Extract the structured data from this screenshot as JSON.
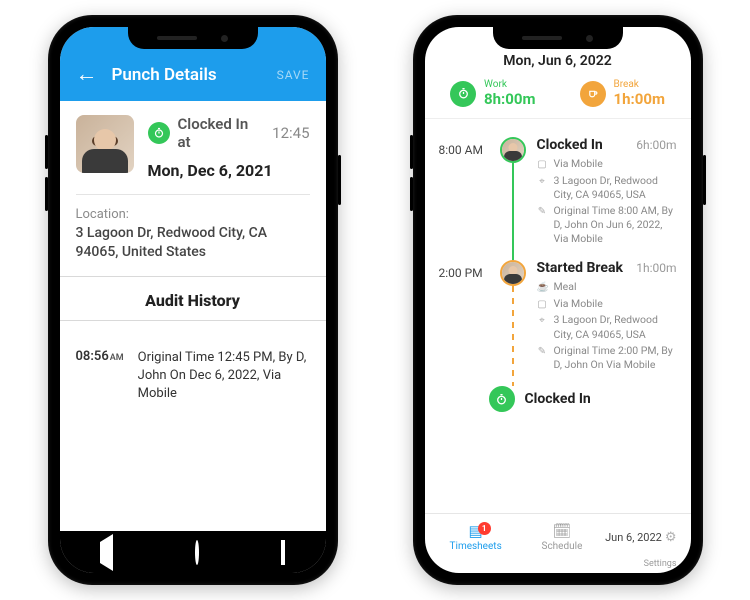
{
  "punchDetails": {
    "header": {
      "title": "Punch Details",
      "saveLabel": "SAVE"
    },
    "clocked": {
      "label": "Clocked In at",
      "time": "12:45"
    },
    "date": "Mon, Dec 6, 2021",
    "locationLabel": "Location:",
    "locationText": "3 Lagoon Dr, Redwood City, CA  94065, United States",
    "auditTitle": "Audit History",
    "audit": {
      "time": "08:56",
      "ampm": "AM",
      "text": "Original Time 12:45 PM, By D, John On Dec 6, 2022, Via Mobile"
    }
  },
  "timeline": {
    "dateTitle": "Mon, Jun 6, 2022",
    "totals": {
      "workLabel": "Work",
      "workValue": "8h:00m",
      "breakLabel": "Break",
      "breakValue": "1h:00m"
    },
    "entries": [
      {
        "time": "8:00 AM",
        "title": "Clocked In",
        "duration": "6h:00m",
        "source": "Via Mobile",
        "location": "3 Lagoon Dr, Redwood City, CA 94065, USA",
        "original": "Original Time 8:00 AM, By D, John On Jun 6, 2022, Via Mobile",
        "color": "green"
      },
      {
        "time": "2:00 PM",
        "title": "Started Break",
        "duration": "1h:00m",
        "meal": "Meal",
        "source": "Via Mobile",
        "location": "3 Lagoon Dr, Redwood City, CA 94065, USA",
        "original": "Original Time 2:00 PM, By D, John On Via Mobile",
        "color": "orange"
      }
    ],
    "cutoffTitle": "Clocked In"
  },
  "bottomNav": {
    "timesheets": "Timesheets",
    "schedule": "Schedule",
    "settings": "Settings",
    "badge": "1",
    "date": "Jun 6, 2022"
  }
}
